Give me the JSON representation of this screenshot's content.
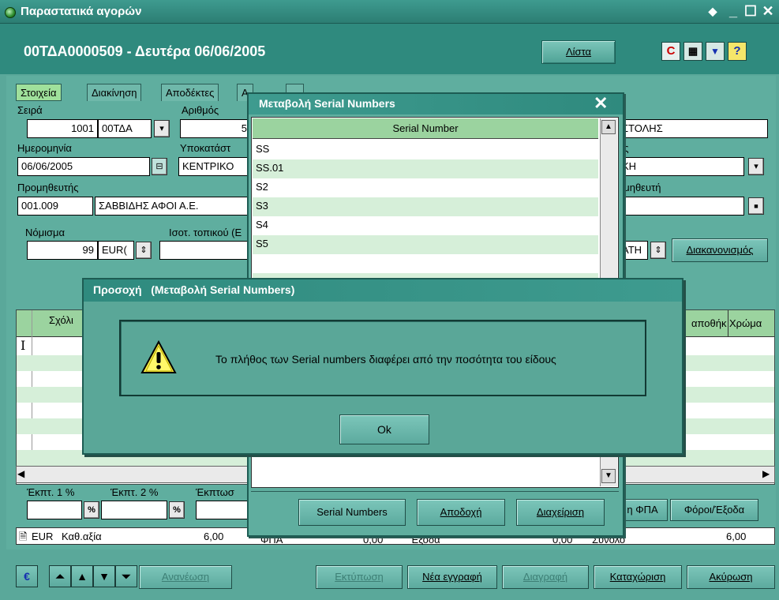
{
  "window": {
    "title": "Παραστατικά αγορών"
  },
  "header": {
    "doc_title": "00ΤΔΑ0000509 - Δευτέρα 06/06/2005",
    "list_button": "Λίστα",
    "icons": [
      "refresh-c-icon",
      "calculator-icon",
      "form-icon",
      "help-icon"
    ]
  },
  "tabs": [
    "Στοιχεία",
    "Διακίνηση",
    "Αποδέκτες",
    "Α",
    "..."
  ],
  "form": {
    "series_label": "Σειρά",
    "series_number": "1001",
    "series_code": "00ΤΔΑ",
    "number_label": "Αριθμός",
    "number_value": "5",
    "shipping_value": "ΣΤΟΛΗΣ",
    "date_label": "Ημερομηνία",
    "date_value": "06/06/2005",
    "branch_label": "Υποκατάστ",
    "branch_value": "ΚΕΝΤΡΙΚΟ",
    "type_label_tail": "ος",
    "type_value": "ΚΗ",
    "supplier_label": "Προμηθευτής",
    "supplier_code": "001.009",
    "supplier_name": "ΣΑΒΒΙΔΗΣ ΑΦΟΙ Α.Ε.",
    "supplier2_label_tail": "ομηθευτή",
    "currency_label": "Νόμισμα",
    "currency_number": "99",
    "currency_code": "EUR(",
    "local_rate_label": "Ισοτ. τοπικού (Ε",
    "settlement_value": "ΑΤΗ",
    "settlement_button": "Διακανονισμός"
  },
  "grid": {
    "col_comments": "Σχόλι",
    "col_warehouse": "αποθήκ",
    "col_color": "Χρώμα",
    "cursor": "I"
  },
  "discounts": {
    "disc1_label": "Έκπτ. 1 %",
    "disc2_label": "Έκπτ. 2 %",
    "discount_label": "Έκπτωσ",
    "pct_symbol": "%",
    "vat_button": "η ΦΠΑ",
    "taxes_button": "Φόροι/Έξοδα"
  },
  "totals": {
    "currency": "EUR",
    "net_value_label": "Καθ.αξία",
    "net_value": "6,00",
    "mid_label_1": "ΦΠΑ",
    "mid_value_1": "0,00",
    "mid_label_2": "Έξοδα",
    "mid_value_2": "0,00",
    "total_label": "Σύνολο",
    "total_value": "6,00"
  },
  "bottom_buttons": {
    "euro": "€",
    "refresh": "Ανανέωση",
    "print": "Εκτύπωση",
    "new_record": "Νέα εγγραφή",
    "delete": "Διαγραφή",
    "save": "Καταχώριση",
    "cancel": "Ακύρωση"
  },
  "serial_dialog": {
    "title": "Μεταβολή Serial Numbers",
    "column_header": "Serial Number",
    "rows": [
      "SS",
      "SS.01",
      "S2",
      "S3",
      "S4",
      "S5"
    ],
    "buttons": {
      "serial_numbers": "Serial Numbers",
      "accept": "Αποδοχή",
      "manage": "Διαχείριση"
    }
  },
  "warning_dialog": {
    "title": "Προσοχή   (Μεταβολή Serial Numbers)",
    "message": "Το πλήθος των Serial numbers διαφέρει από την ποσότητα του είδους",
    "ok": "Ok",
    "icon": "warning-icon"
  }
}
